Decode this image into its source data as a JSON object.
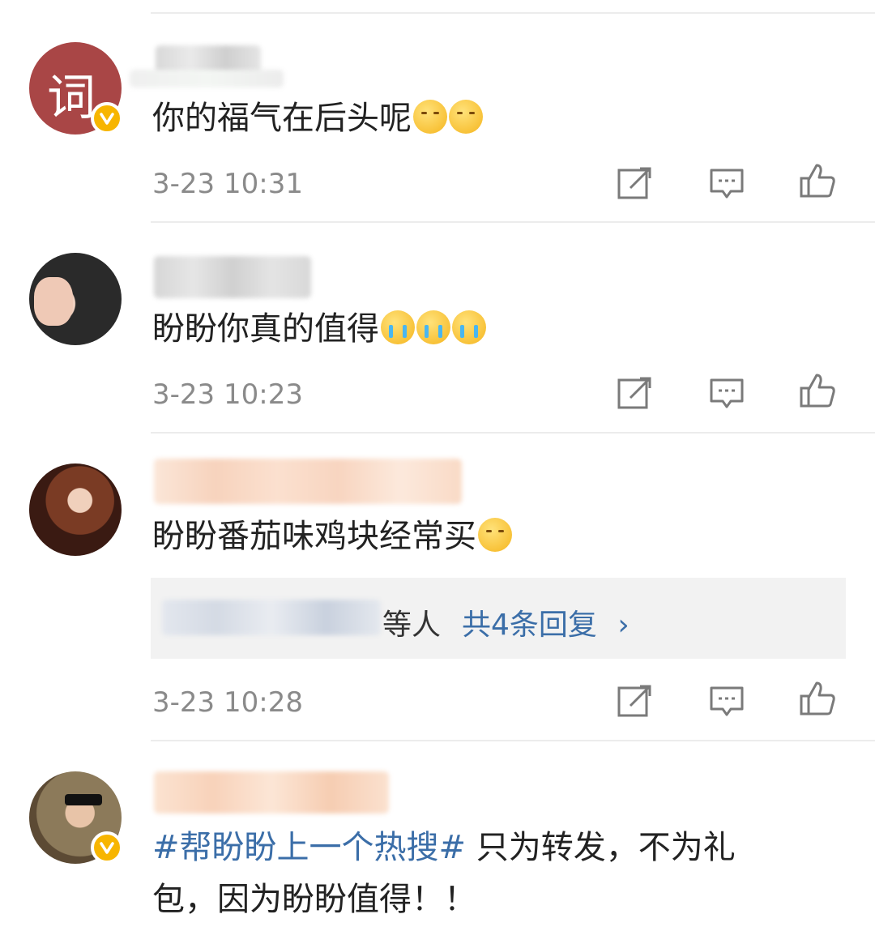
{
  "comments": [
    {
      "avatar_text": "词",
      "text": "你的福气在后头呢",
      "emojis": [
        "kiss",
        "kiss"
      ],
      "time": "3-23 10:31",
      "verified": true
    },
    {
      "text": "盼盼你真的值得",
      "emojis": [
        "cry",
        "cry",
        "cry"
      ],
      "time": "3-23 10:23",
      "verified": false
    },
    {
      "text": "盼盼番茄味鸡块经常买",
      "emojis": [
        "yum"
      ],
      "time": "3-23 10:28",
      "verified": false,
      "replies": {
        "suffix": "等人",
        "link": "共4条回复",
        "chevron": "›"
      }
    },
    {
      "topic": "#帮盼盼上一个热搜#",
      "text_line1": " 只为转发，不为礼",
      "text_line2": "包，因为盼盼值得！！",
      "verified": true
    }
  ],
  "icons": [
    "repost-icon",
    "comment-icon",
    "like-icon"
  ],
  "colors": {
    "link": "#3b6ea8",
    "time": "#8a8a8a",
    "divider": "#ececec",
    "badge": "#f7b500"
  }
}
